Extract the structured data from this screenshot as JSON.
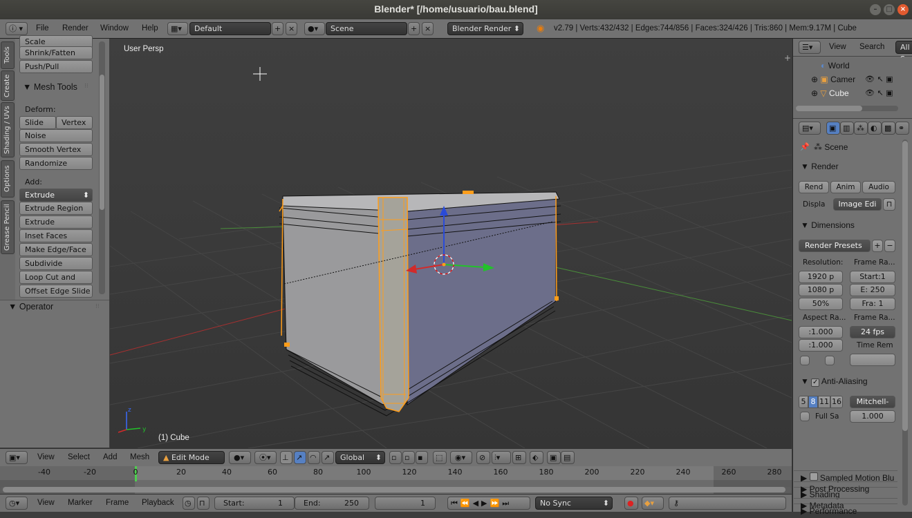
{
  "window": {
    "title": "Blender* [/home/usuario/bau.blend]"
  },
  "info_header": {
    "menus": [
      "File",
      "Render",
      "Window",
      "Help"
    ],
    "screen_layout": "Default",
    "scene": "Scene",
    "render_engine": "Blender Render",
    "stats": "v2.79 | Verts:432/432 | Edges:744/856 | Faces:324/426 | Tris:860 | Mem:9.17M | Cube"
  },
  "tool_tabs": [
    "Tools",
    "Create",
    "Shading / UVs",
    "Options",
    "Grease Pencil"
  ],
  "tools": {
    "top_buttons": [
      "Scale",
      "Shrink/Fatten",
      "Push/Pull"
    ],
    "mesh_tools_title": "Mesh Tools",
    "deform_label": "Deform:",
    "slide_edge": "Slide Ed",
    "vertex": "Vertex",
    "deform_buttons": [
      "Noise",
      "Smooth Vertex",
      "Randomize"
    ],
    "add_label": "Add:",
    "extrude": "Extrude",
    "add_buttons": [
      "Extrude Region",
      "Extrude Individual",
      "Inset Faces",
      "Make Edge/Face",
      "Subdivide",
      "Loop Cut and Slide",
      "Offset Edge Slide"
    ],
    "operator_title": "Operator"
  },
  "viewport": {
    "view_label": "User Persp",
    "object_label": "(1) Cube"
  },
  "view3d_header": {
    "menus": [
      "View",
      "Select",
      "Add",
      "Mesh"
    ],
    "mode": "Edit Mode",
    "orientation": "Global"
  },
  "timeline": {
    "ticks": [
      "-40",
      "-20",
      "0",
      "20",
      "40",
      "60",
      "80",
      "100",
      "120",
      "140",
      "160",
      "180",
      "200",
      "220",
      "240",
      "260",
      "280"
    ],
    "current_frame": 1
  },
  "timeline_header": {
    "menus": [
      "View",
      "Marker",
      "Frame",
      "Playback"
    ],
    "start_label": "Start:",
    "start_value": "1",
    "end_label": "End:",
    "end_value": "250",
    "current": "1",
    "sync": "No Sync"
  },
  "outliner": {
    "menus": [
      "View",
      "Search",
      "All S"
    ],
    "items": [
      "World",
      "Camer",
      "Cube"
    ]
  },
  "properties": {
    "breadcrumb": "Scene",
    "render_title": "Render",
    "render_buttons": [
      "Rend",
      "Anim",
      "Audio"
    ],
    "display_label": "Displa",
    "display_value": "Image Edi",
    "dimensions_title": "Dimensions",
    "render_presets": "Render Presets",
    "resolution_label": "Resolution:",
    "res_x": "1920 p",
    "res_y": "1080 p",
    "res_pct": "50%",
    "frame_range_label": "Frame Ra...",
    "frame_start": "Start:1",
    "frame_end": "E: 250",
    "frame_step": "Fra:  1",
    "aspect_label": "Aspect Ra...",
    "aspect_x": ":1.000",
    "aspect_y": ":1.000",
    "frame_rate_label": "Frame Ra...",
    "fps": "24 fps",
    "time_remap_label": "Time Rem",
    "aa_title": "Anti-Aliasing",
    "aa_samples": [
      "5",
      "8",
      "11",
      "16"
    ],
    "aa_filter": "Mitchell-",
    "full_sample": "Full Sa",
    "filter_size": "1.000",
    "collapsed_panels": [
      "Sampled Motion Blu",
      "Shading",
      "Performance",
      "Post Processing",
      "Metadata"
    ]
  },
  "colors": {
    "accent": "#5680c2",
    "selection": "#ffa020",
    "close": "#e25a2f"
  }
}
